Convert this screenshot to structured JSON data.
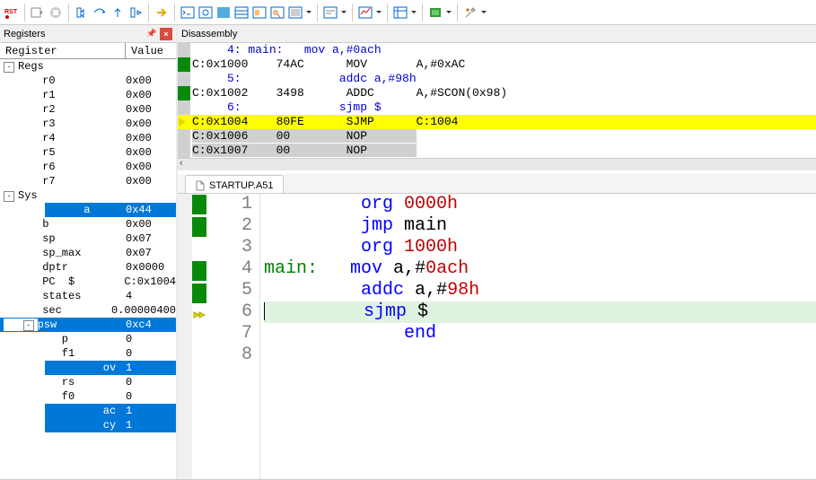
{
  "toolbar": {
    "rst_label": "RST"
  },
  "registers": {
    "title": "Registers",
    "col1": "Register",
    "col2": "Value",
    "groups": [
      {
        "name": "Regs",
        "rows": [
          {
            "name": "r0",
            "val": "0x00"
          },
          {
            "name": "r1",
            "val": "0x00"
          },
          {
            "name": "r2",
            "val": "0x00"
          },
          {
            "name": "r3",
            "val": "0x00"
          },
          {
            "name": "r4",
            "val": "0x00"
          },
          {
            "name": "r5",
            "val": "0x00"
          },
          {
            "name": "r6",
            "val": "0x00"
          },
          {
            "name": "r7",
            "val": "0x00"
          }
        ]
      },
      {
        "name": "Sys",
        "rows": [
          {
            "name": "a",
            "val": "0x44",
            "sel": true
          },
          {
            "name": "b",
            "val": "0x00"
          },
          {
            "name": "sp",
            "val": "0x07"
          },
          {
            "name": "sp_max",
            "val": "0x07"
          },
          {
            "name": "dptr",
            "val": "0x0000"
          },
          {
            "name": "PC  $",
            "val": "C:0x1004"
          },
          {
            "name": "states",
            "val": "4"
          },
          {
            "name": "sec",
            "val": "0.00000400"
          }
        ]
      }
    ],
    "psw": {
      "name": "psw",
      "val": "0xc4",
      "bits": [
        {
          "name": "p",
          "val": "0"
        },
        {
          "name": "f1",
          "val": "0"
        },
        {
          "name": "ov",
          "val": "1",
          "sel": true
        },
        {
          "name": "rs",
          "val": "0"
        },
        {
          "name": "f0",
          "val": "0"
        },
        {
          "name": "ac",
          "val": "1",
          "sel": true
        },
        {
          "name": "cy",
          "val": "1",
          "sel": true
        }
      ]
    }
  },
  "disassembly": {
    "title": "Disassembly",
    "rows": [
      {
        "type": "src",
        "text": "     4: main:   mov a,#0ach "
      },
      {
        "type": "asm",
        "g": "grn",
        "addr": "C:0x1000",
        "bytes": "74AC",
        "mn": "MOV",
        "ops": "A,#0xAC"
      },
      {
        "type": "src",
        "text": "     5:              addc a,#98h "
      },
      {
        "type": "asm",
        "g": "grn",
        "addr": "C:0x1002",
        "bytes": "3498",
        "mn": "ADDC",
        "ops": "A,#SCON(0x98)"
      },
      {
        "type": "src",
        "text": "     6:              sjmp $ "
      },
      {
        "type": "asm",
        "g": "arrow",
        "cur": true,
        "addr": "C:0x1004",
        "bytes": "80FE",
        "mn": "SJMP",
        "ops": "C:1004"
      },
      {
        "type": "asm",
        "g": "grey",
        "addr": "C:0x1006",
        "bytes": "00",
        "mn": "NOP",
        "ops": ""
      },
      {
        "type": "asm",
        "g": "grey",
        "addr": "C:0x1007",
        "bytes": "00",
        "mn": "NOP",
        "ops": ""
      }
    ]
  },
  "editor": {
    "tab": "STARTUP.A51",
    "lines": [
      {
        "n": 1,
        "mk": "grn",
        "kw": "org ",
        "num": "0000h"
      },
      {
        "n": 2,
        "mk": "grn",
        "kw": "jmp ",
        "txt": "main"
      },
      {
        "n": 3,
        "mk": "",
        "kw": "org ",
        "num": "1000h"
      },
      {
        "n": 4,
        "mk": "grn",
        "lbl": "main:",
        "kw": "mov ",
        "reg": "a",
        "comma": ",#",
        "num": "0ach"
      },
      {
        "n": 5,
        "mk": "grn",
        "kw": "addc ",
        "reg": "a",
        "comma": ",#",
        "num": "98h"
      },
      {
        "n": 6,
        "mk": "cur",
        "cur": true,
        "kw": "sjmp ",
        "txt": "$"
      },
      {
        "n": 7,
        "mk": "",
        "end": "end"
      },
      {
        "n": 8,
        "mk": ""
      }
    ]
  }
}
